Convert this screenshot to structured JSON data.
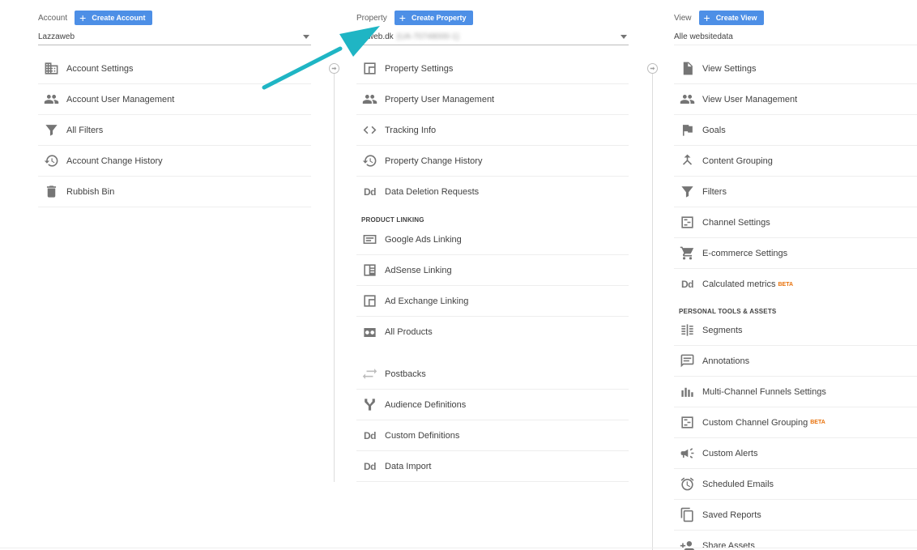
{
  "account": {
    "label": "Account",
    "create_label": "Create Account",
    "selected": "Lazzaweb",
    "items": [
      {
        "label": "Account Settings"
      },
      {
        "label": "Account User Management"
      },
      {
        "label": "All Filters"
      },
      {
        "label": "Account Change History"
      },
      {
        "label": "Rubbish Bin"
      }
    ]
  },
  "property": {
    "label": "Property",
    "create_label": "Create Property",
    "selected": "web.dk",
    "selected_blurred": "(UA-70748000-1)",
    "items": [
      {
        "label": "Property Settings"
      },
      {
        "label": "Property User Management"
      },
      {
        "label": "Tracking Info"
      },
      {
        "label": "Property Change History"
      },
      {
        "label": "Data Deletion Requests"
      }
    ],
    "section_product_linking": "PRODUCT LINKING",
    "linking_items": [
      {
        "label": "Google Ads Linking"
      },
      {
        "label": "AdSense Linking"
      },
      {
        "label": "Ad Exchange Linking"
      },
      {
        "label": "All Products"
      }
    ],
    "other_items": [
      {
        "label": "Postbacks"
      },
      {
        "label": "Audience Definitions"
      },
      {
        "label": "Custom Definitions"
      },
      {
        "label": "Data Import"
      }
    ]
  },
  "view": {
    "label": "View",
    "create_label": "Create View",
    "selected": "Alle websitedata",
    "items": [
      {
        "label": "View Settings"
      },
      {
        "label": "View User Management"
      },
      {
        "label": "Goals"
      },
      {
        "label": "Content Grouping"
      },
      {
        "label": "Filters"
      },
      {
        "label": "Channel Settings"
      },
      {
        "label": "E-commerce Settings"
      },
      {
        "label": "Calculated metrics",
        "badge": "BETA"
      }
    ],
    "section_personal_tools": "PERSONAL TOOLS & ASSETS",
    "tools_items": [
      {
        "label": "Segments"
      },
      {
        "label": "Annotations"
      },
      {
        "label": "Multi-Channel Funnels Settings"
      },
      {
        "label": "Custom Channel Grouping",
        "badge": "BETA"
      },
      {
        "label": "Custom Alerts"
      },
      {
        "label": "Scheduled Emails"
      },
      {
        "label": "Saved Reports"
      },
      {
        "label": "Share Assets"
      }
    ]
  },
  "colors": {
    "button_blue": "#4d8fe6",
    "beta_orange": "#e8710a",
    "annotation_arrow": "#1fb5c4"
  }
}
